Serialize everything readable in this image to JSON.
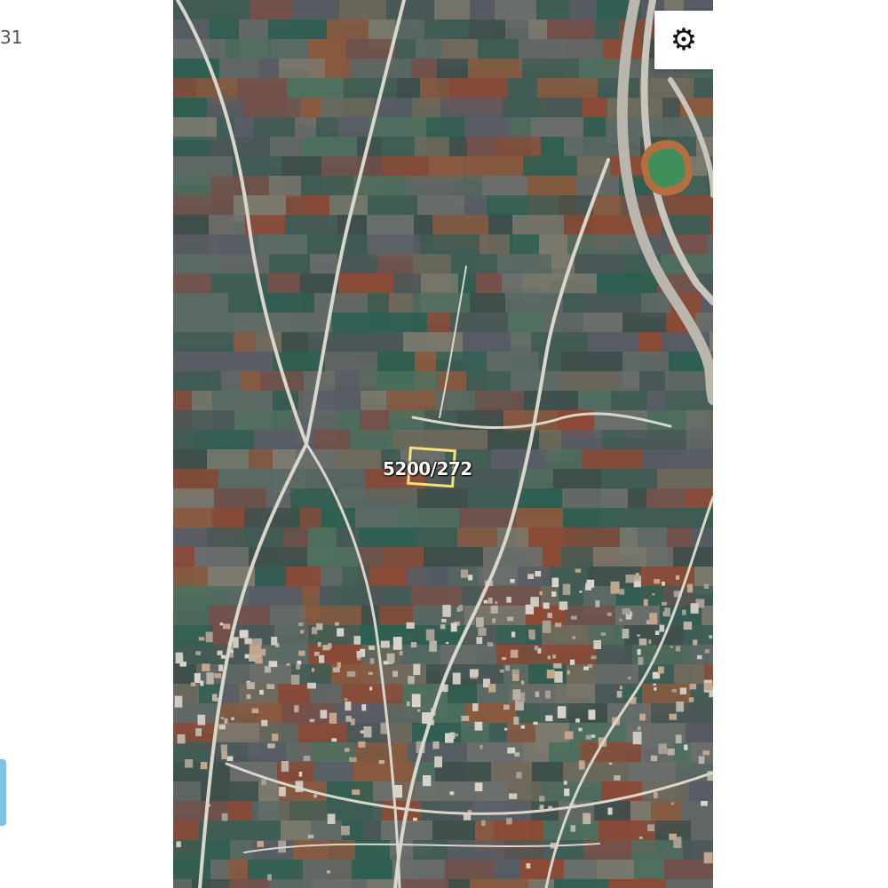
{
  "side_text": "31",
  "map": {
    "view": "satellite",
    "parcel_label": "5200/272",
    "settings_icon": "gear-icon",
    "settings_glyph": "⚙",
    "colors": {
      "parcel_outline": "#f5e27a",
      "road": "#d9d6cc",
      "side_tab": "#7fc3e6"
    }
  }
}
